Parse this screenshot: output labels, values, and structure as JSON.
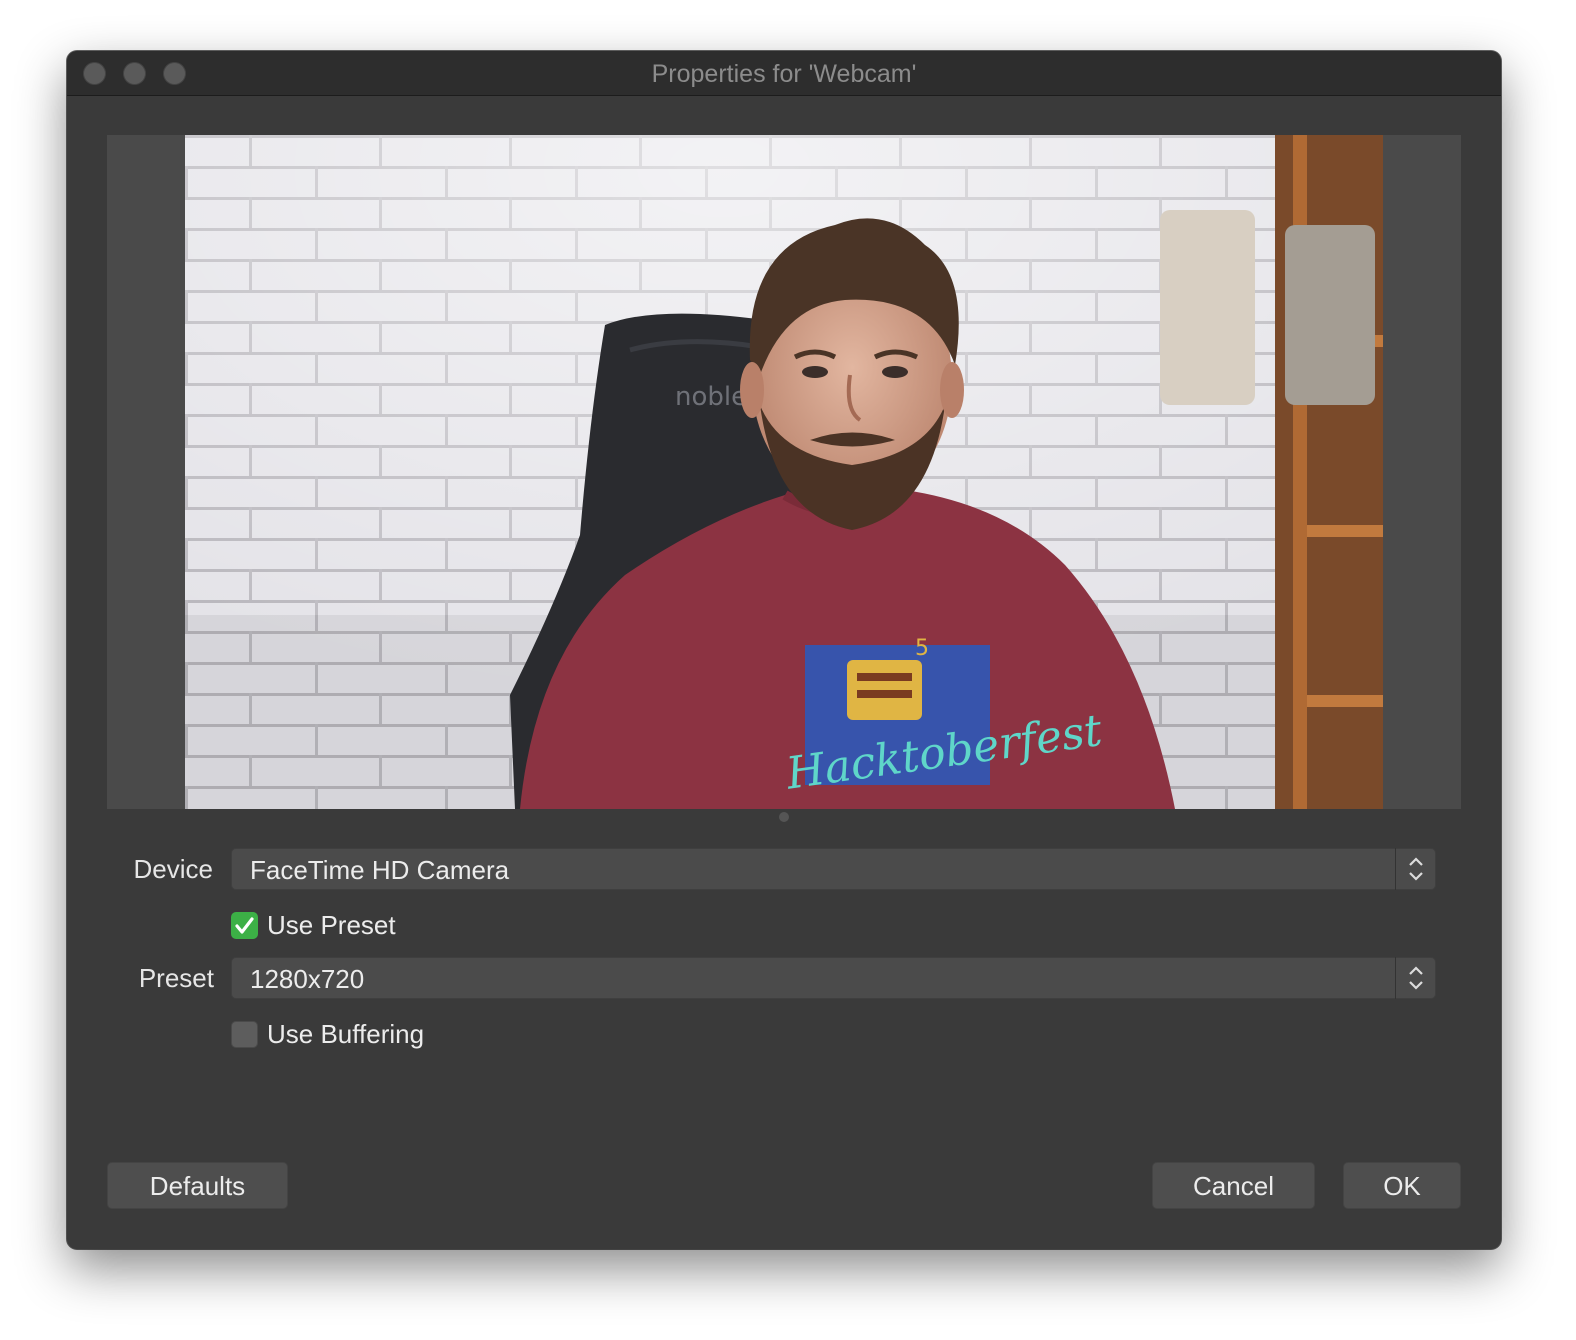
{
  "window": {
    "title": "Properties for 'Webcam'"
  },
  "preview": {
    "chair_brand_text": "noble",
    "shirt_text": "Hacktoberfest",
    "shirt_number": "5"
  },
  "form": {
    "device_label": "Device",
    "device_value": "FaceTime HD Camera",
    "use_preset_label": "Use Preset",
    "use_preset_checked": true,
    "preset_label": "Preset",
    "preset_value": "1280x720",
    "use_buffering_label": "Use Buffering",
    "use_buffering_checked": false
  },
  "buttons": {
    "defaults": "Defaults",
    "cancel": "Cancel",
    "ok": "OK"
  },
  "colors": {
    "checkbox_on": "#3cb046",
    "window_bg": "#3a3a3a"
  }
}
